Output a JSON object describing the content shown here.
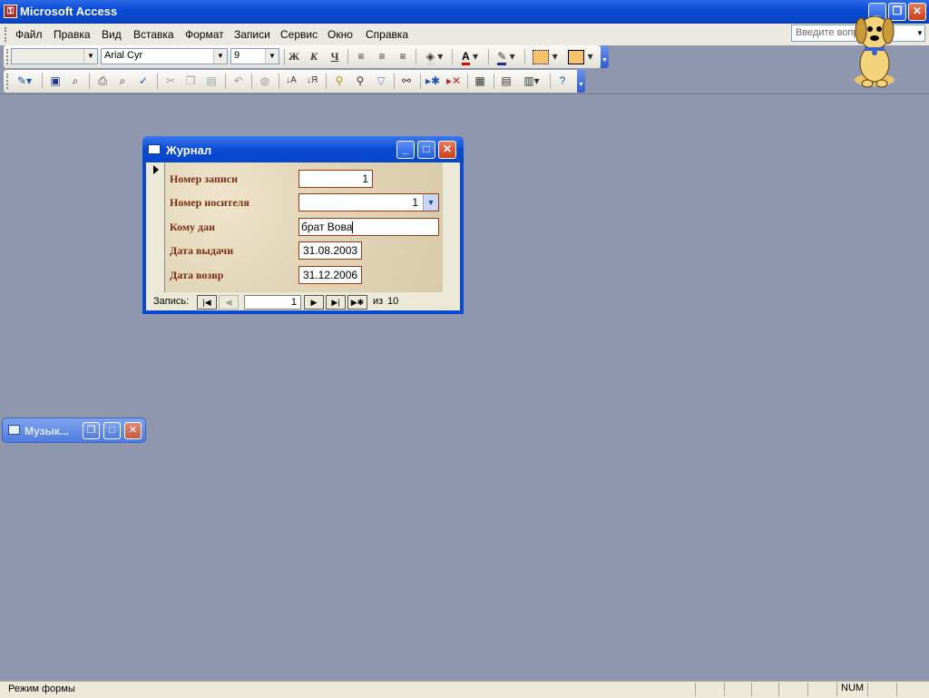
{
  "app": {
    "title": "Microsoft Access",
    "title_icon": "key-icon"
  },
  "caption_buttons": {
    "minimize": "_",
    "restore": "❐",
    "close": "✕"
  },
  "menu": {
    "items": [
      "Файл",
      "Правка",
      "Вид",
      "Вставка",
      "Формат",
      "Записи",
      "Сервис",
      "Окно",
      "Справка"
    ],
    "ask_placeholder": "Введите вопрос"
  },
  "format_toolbar": {
    "object_value": "",
    "font_name": "Arial Cyr",
    "font_size": "9",
    "bold": "Ж",
    "italic": "К",
    "underline": "Ч",
    "font_color": "A"
  },
  "form_window": {
    "title": "Журнал",
    "fields": [
      {
        "label": "Номер записи",
        "value": "1"
      },
      {
        "label": "Номер носителя",
        "value": "1"
      },
      {
        "label": "Кому дан",
        "value": "брат Вова"
      },
      {
        "label": "Дата выдачи",
        "value": "31.08.2003"
      },
      {
        "label": "Дата возвр",
        "value": "31.12.2006"
      }
    ],
    "navigation": {
      "label": "Запись:",
      "current": "1",
      "of_label": "из",
      "total": "10"
    }
  },
  "minimized_window": {
    "title": "Музык..."
  },
  "status": {
    "mode": "Режим формы",
    "num": "NUM"
  },
  "colors": {
    "titlebar": "#0A4BD6",
    "client_bg": "#8E97AE",
    "field_label": "#7A2A10",
    "field_border": "#9A3A1A"
  }
}
